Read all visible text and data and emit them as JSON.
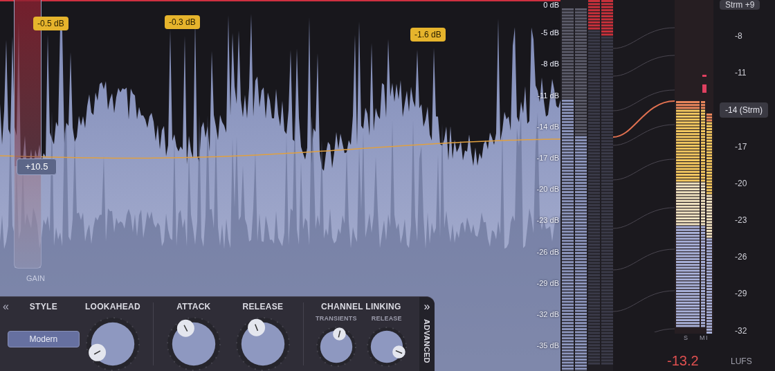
{
  "waveform_display": {
    "scale": [
      "0 dB",
      "-5 dB",
      "-8 dB",
      "-11 dB",
      "-14 dB",
      "-17 dB",
      "-20 dB",
      "-23 dB",
      "-26 dB",
      "-29 dB",
      "-32 dB",
      "-35 dB"
    ],
    "peak_tags": [
      {
        "label": "-0.5 dB"
      },
      {
        "label": "-0.3 dB"
      },
      {
        "label": "-1.6 dB"
      }
    ],
    "gain": {
      "label": "GAIN",
      "value": "+10.5",
      "level": 0.38
    }
  },
  "controls": {
    "collapse": "«",
    "expand": "»",
    "advanced": "ADVANCED",
    "style": {
      "label": "STYLE",
      "value": "Modern"
    },
    "knobs": [
      {
        "label": "LOOKAHEAD",
        "level": 0.06
      },
      {
        "label": "ATTACK",
        "level": 0.4
      },
      {
        "label": "RELEASE",
        "level": 0.42
      }
    ],
    "channel_linking": {
      "label": "CHANNEL LINKING",
      "knobs": [
        {
          "label": "TRANSIENTS",
          "level": 0.55
        },
        {
          "label": "RELEASE",
          "level": 0.92
        }
      ]
    }
  },
  "loudness": {
    "top_target": "Strm +9",
    "target": "-14 (Strm)",
    "scale": [
      "-8",
      "-11",
      "-17",
      "-20",
      "-23",
      "-26",
      "-29",
      "-32"
    ],
    "meter_labels": [
      "S",
      "M",
      "I"
    ],
    "value": "-13.2",
    "unit": "LUFS"
  }
}
